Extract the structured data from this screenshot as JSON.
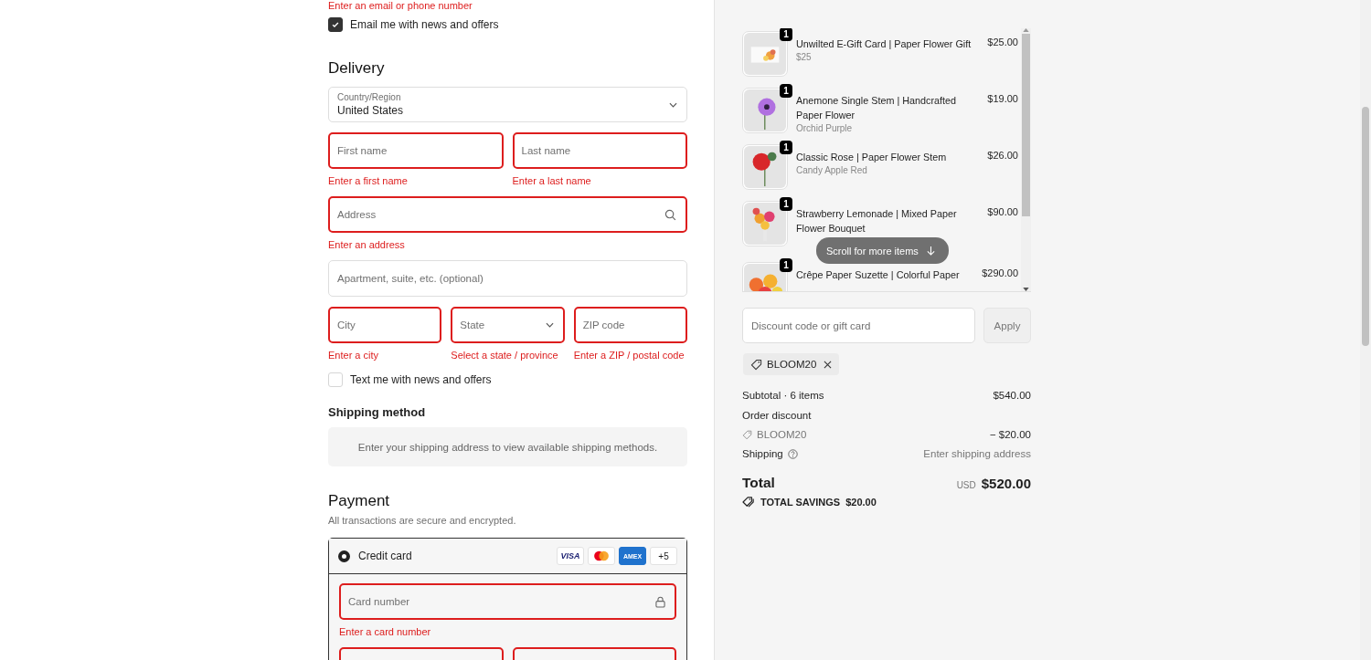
{
  "contact": {
    "error": "Enter an email or phone number",
    "email_news": {
      "label": "Email me with news and offers",
      "checked": true
    }
  },
  "delivery": {
    "title": "Delivery",
    "country": {
      "label": "Country/Region",
      "value": "United States"
    },
    "rows": [
      [
        {
          "kind": "text",
          "placeholder": "First name",
          "error": "Enter a first name"
        },
        {
          "kind": "text",
          "placeholder": "Last name",
          "error": "Enter a last name"
        }
      ],
      [
        {
          "kind": "search",
          "placeholder": "Address",
          "error": "Enter an address"
        }
      ],
      [
        {
          "kind": "text",
          "placeholder": "Apartment, suite, etc. (optional)"
        }
      ],
      [
        {
          "kind": "text",
          "placeholder": "City",
          "error": "Enter a city"
        },
        {
          "kind": "select",
          "placeholder": "State",
          "error": "Select a state / province"
        },
        {
          "kind": "text",
          "placeholder": "ZIP code",
          "error": "Enter a ZIP / postal code"
        }
      ]
    ],
    "sms_news": {
      "label": "Text me with news and offers",
      "checked": false
    }
  },
  "shipping_method": {
    "title": "Shipping method",
    "message": "Enter your shipping address to view available shipping methods."
  },
  "payment": {
    "title": "Payment",
    "subtitle": "All transactions are secure and encrypted.",
    "method": {
      "label": "Credit card",
      "selected": true,
      "brands": [
        {
          "kind": "visa",
          "text": "VISA"
        },
        {
          "kind": "mastercard"
        },
        {
          "kind": "amex",
          "text": "AMEX"
        }
      ],
      "more": "+5"
    },
    "card_fields": [
      {
        "kind": "lock",
        "placeholder": "Card number",
        "error": "Enter a card number"
      }
    ]
  },
  "cart": {
    "items": [
      {
        "quantity": "1",
        "name": "Unwilted E-Gift Card | Paper Flower Gift",
        "variant": "$25",
        "price": "$25.00"
      },
      {
        "quantity": "1",
        "name": "Anemone Single Stem | Handcrafted Paper Flower",
        "variant": "Orchid Purple",
        "price": "$19.00"
      },
      {
        "quantity": "1",
        "name": "Classic Rose | Paper Flower Stem",
        "variant": "Candy Apple Red",
        "price": "$26.00"
      },
      {
        "quantity": "1",
        "name": "Strawberry Lemonade | Mixed Paper Flower Bouquet",
        "price": "$90.00"
      },
      {
        "quantity": "1",
        "name": "Crêpe Paper Suzette | Colorful Paper",
        "price": "$290.00"
      }
    ],
    "scroll_hint": "Scroll for more items"
  },
  "discount": {
    "placeholder": "Discount code or gift card",
    "button": "Apply",
    "applied": "BLOOM20"
  },
  "summary": {
    "subtotal_label": "Subtotal · 6 items",
    "subtotal": "$540.00",
    "discount_label": "Order discount",
    "discount_code": "BLOOM20",
    "discount_amount": "− $20.00",
    "shipping_label": "Shipping",
    "shipping_value": "Enter shipping address",
    "total_label": "Total",
    "currency": "USD",
    "total": "$520.00",
    "savings_label": "TOTAL SAVINGS",
    "savings": "$20.00"
  }
}
